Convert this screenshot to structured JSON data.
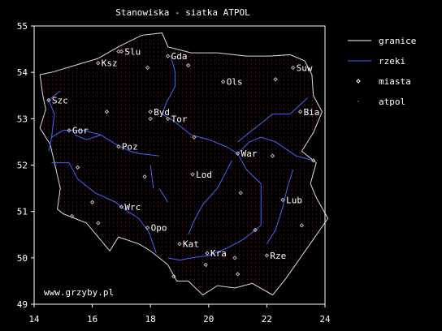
{
  "chart_data": {
    "type": "scatter",
    "title": "Stanowiska - siatka ATPOL",
    "xlim": [
      14,
      24
    ],
    "ylim": [
      49,
      55
    ],
    "x_ticks": [
      14,
      16,
      18,
      20,
      22,
      24
    ],
    "y_ticks": [
      49,
      50,
      51,
      52,
      53,
      54,
      55
    ],
    "grid": false,
    "legend_position": "right",
    "legend": [
      {
        "label": "granice",
        "color": "#ffffff",
        "kind": "line"
      },
      {
        "label": "rzeki",
        "color": "#4466ff",
        "kind": "line"
      },
      {
        "label": "miasta",
        "color": "#ffffff",
        "kind": "diamond"
      },
      {
        "label": "atpol",
        "color": "#ff2222",
        "kind": "dot"
      }
    ],
    "annotation": "www.grzyby.pl",
    "cities": [
      {
        "name": "Gda",
        "lon": 18.6,
        "lat": 54.35
      },
      {
        "name": "Slu",
        "lon": 17.0,
        "lat": 54.45
      },
      {
        "name": "Ksz",
        "lon": 16.2,
        "lat": 54.2
      },
      {
        "name": "Suw",
        "lon": 22.9,
        "lat": 54.1
      },
      {
        "name": "Ols",
        "lon": 20.5,
        "lat": 53.8
      },
      {
        "name": "Szc",
        "lon": 14.5,
        "lat": 53.4
      },
      {
        "name": "Byd",
        "lon": 18.0,
        "lat": 53.15
      },
      {
        "name": "Tor",
        "lon": 18.6,
        "lat": 53.0
      },
      {
        "name": "Bia",
        "lon": 23.15,
        "lat": 53.15
      },
      {
        "name": "Gor",
        "lon": 15.2,
        "lat": 52.75
      },
      {
        "name": "Poz",
        "lon": 16.9,
        "lat": 52.4
      },
      {
        "name": "War",
        "lon": 21.0,
        "lat": 52.25
      },
      {
        "name": "Lod",
        "lon": 19.45,
        "lat": 51.8
      },
      {
        "name": "Lub",
        "lon": 22.55,
        "lat": 51.25
      },
      {
        "name": "Wrc",
        "lon": 17.0,
        "lat": 51.1
      },
      {
        "name": "Opo",
        "lon": 17.9,
        "lat": 50.65
      },
      {
        "name": "Kat",
        "lon": 19.0,
        "lat": 50.3
      },
      {
        "name": "Kra",
        "lon": 19.95,
        "lat": 50.1
      },
      {
        "name": "Rze",
        "lon": 22.0,
        "lat": 50.05
      }
    ],
    "minor_places": [
      {
        "lon": 16.9,
        "lat": 54.45
      },
      {
        "lon": 17.9,
        "lat": 54.1
      },
      {
        "lon": 19.3,
        "lat": 54.15
      },
      {
        "lon": 22.3,
        "lat": 53.85
      },
      {
        "lon": 16.5,
        "lat": 53.15
      },
      {
        "lon": 18.0,
        "lat": 53.0
      },
      {
        "lon": 19.5,
        "lat": 52.6
      },
      {
        "lon": 22.2,
        "lat": 52.2
      },
      {
        "lon": 23.6,
        "lat": 52.1
      },
      {
        "lon": 15.5,
        "lat": 51.95
      },
      {
        "lon": 17.8,
        "lat": 51.75
      },
      {
        "lon": 21.1,
        "lat": 51.4
      },
      {
        "lon": 16.0,
        "lat": 51.2
      },
      {
        "lon": 15.3,
        "lat": 50.9
      },
      {
        "lon": 16.2,
        "lat": 50.75
      },
      {
        "lon": 21.6,
        "lat": 50.6
      },
      {
        "lon": 23.2,
        "lat": 50.7
      },
      {
        "lon": 20.9,
        "lat": 50.0
      },
      {
        "lon": 19.9,
        "lat": 49.85
      },
      {
        "lon": 21.0,
        "lat": 49.65
      },
      {
        "lon": 18.8,
        "lat": 49.6
      }
    ],
    "border": [
      [
        14.2,
        53.95
      ],
      [
        14.6,
        54.0
      ],
      [
        15.4,
        54.15
      ],
      [
        16.2,
        54.3
      ],
      [
        16.9,
        54.55
      ],
      [
        17.7,
        54.8
      ],
      [
        18.4,
        54.85
      ],
      [
        18.6,
        54.55
      ],
      [
        19.4,
        54.42
      ],
      [
        20.3,
        54.42
      ],
      [
        21.3,
        54.35
      ],
      [
        22.1,
        54.35
      ],
      [
        22.8,
        54.38
      ],
      [
        23.3,
        54.25
      ],
      [
        23.55,
        53.95
      ],
      [
        23.6,
        53.5
      ],
      [
        23.9,
        53.15
      ],
      [
        23.6,
        52.7
      ],
      [
        23.2,
        52.3
      ],
      [
        23.7,
        52.05
      ],
      [
        23.5,
        51.6
      ],
      [
        23.7,
        51.3
      ],
      [
        24.1,
        50.85
      ],
      [
        23.6,
        50.4
      ],
      [
        22.65,
        49.55
      ],
      [
        22.2,
        49.2
      ],
      [
        21.5,
        49.45
      ],
      [
        20.9,
        49.35
      ],
      [
        20.3,
        49.4
      ],
      [
        19.8,
        49.2
      ],
      [
        19.3,
        49.5
      ],
      [
        18.9,
        49.5
      ],
      [
        18.6,
        49.85
      ],
      [
        18.0,
        50.15
      ],
      [
        17.6,
        50.3
      ],
      [
        16.9,
        50.45
      ],
      [
        16.6,
        50.15
      ],
      [
        16.2,
        50.45
      ],
      [
        15.8,
        50.75
      ],
      [
        15.0,
        50.95
      ],
      [
        14.8,
        51.05
      ],
      [
        14.9,
        51.5
      ],
      [
        14.7,
        52.05
      ],
      [
        14.55,
        52.45
      ],
      [
        14.2,
        52.8
      ],
      [
        14.4,
        53.2
      ],
      [
        14.3,
        53.5
      ],
      [
        14.2,
        53.95
      ]
    ],
    "rivers": [
      [
        [
          18.7,
          54.35
        ],
        [
          18.85,
          54.0
        ],
        [
          18.85,
          53.7
        ],
        [
          18.55,
          53.35
        ],
        [
          18.4,
          53.1
        ],
        [
          18.8,
          52.95
        ],
        [
          19.1,
          52.8
        ],
        [
          19.4,
          52.65
        ],
        [
          20.0,
          52.55
        ],
        [
          20.6,
          52.4
        ],
        [
          21.0,
          52.25
        ],
        [
          21.3,
          51.9
        ],
        [
          21.8,
          51.6
        ],
        [
          21.8,
          51.2
        ],
        [
          21.8,
          50.7
        ],
        [
          21.2,
          50.4
        ],
        [
          20.6,
          50.2
        ],
        [
          20.0,
          50.05
        ],
        [
          19.4,
          50.0
        ],
        [
          19.0,
          49.95
        ],
        [
          18.6,
          50.0
        ]
      ],
      [
        [
          14.6,
          52.6
        ],
        [
          15.0,
          52.75
        ],
        [
          15.7,
          52.75
        ],
        [
          16.3,
          52.65
        ],
        [
          16.8,
          52.45
        ],
        [
          17.3,
          52.3
        ],
        [
          17.6,
          52.25
        ],
        [
          18.3,
          52.2
        ]
      ],
      [
        [
          16.3,
          52.65
        ],
        [
          15.8,
          52.55
        ],
        [
          15.4,
          52.65
        ]
      ],
      [
        [
          14.6,
          52.05
        ],
        [
          15.2,
          52.05
        ],
        [
          15.5,
          51.7
        ],
        [
          16.1,
          51.4
        ],
        [
          16.8,
          51.2
        ],
        [
          17.1,
          51.05
        ],
        [
          17.6,
          50.85
        ],
        [
          17.95,
          50.55
        ],
        [
          18.2,
          50.1
        ]
      ],
      [
        [
          23.6,
          52.1
        ],
        [
          23.0,
          52.2
        ],
        [
          22.3,
          52.5
        ],
        [
          21.8,
          52.6
        ],
        [
          21.4,
          52.5
        ],
        [
          21.0,
          52.25
        ]
      ],
      [
        [
          23.4,
          53.45
        ],
        [
          22.8,
          53.1
        ],
        [
          22.2,
          53.1
        ],
        [
          21.5,
          52.75
        ],
        [
          21.0,
          52.5
        ]
      ],
      [
        [
          20.8,
          52.1
        ],
        [
          20.3,
          51.5
        ],
        [
          19.8,
          51.15
        ],
        [
          19.5,
          50.8
        ],
        [
          19.3,
          50.5
        ]
      ],
      [
        [
          22.9,
          51.9
        ],
        [
          22.7,
          51.5
        ],
        [
          22.55,
          51.1
        ],
        [
          22.3,
          50.6
        ],
        [
          22.0,
          50.3
        ]
      ],
      [
        [
          14.9,
          53.6
        ],
        [
          14.5,
          53.4
        ],
        [
          14.7,
          53.1
        ],
        [
          14.6,
          52.6
        ],
        [
          14.5,
          52.3
        ]
      ],
      [
        [
          18.3,
          51.5
        ],
        [
          18.6,
          51.2
        ]
      ],
      [
        [
          18.0,
          52.0
        ],
        [
          18.1,
          51.5
        ]
      ]
    ]
  }
}
